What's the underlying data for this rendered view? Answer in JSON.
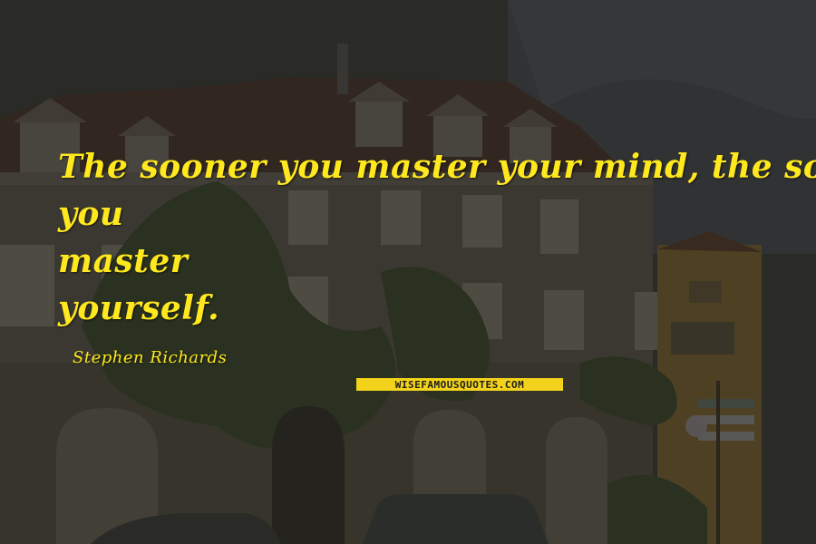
{
  "quote": {
    "lines": [
      "The sooner you master your mind, the sooner",
      "you",
      "master",
      "yourself."
    ],
    "author": "Stephen Richards"
  },
  "watermark": {
    "text": "WISEFAMOUSQUOTES.COM"
  },
  "colors": {
    "quote_text": "#ffe81e",
    "badge_bg": "#f2d21b",
    "overlay": "#1e1e1b"
  }
}
